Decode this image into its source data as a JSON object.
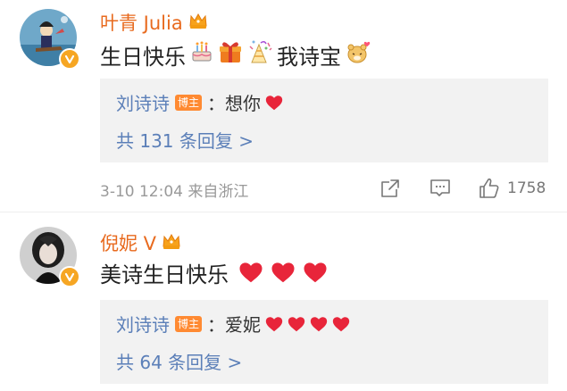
{
  "comments": [
    {
      "username": "叶青 Julia",
      "text": "生日快乐",
      "text_suffix": "我诗宝",
      "emojis_before": [
        "birthday-cake",
        "gift",
        "party-popper"
      ],
      "emojis_after": [
        "hamster-heart"
      ],
      "reply": {
        "author": "刘诗诗",
        "badge": "博主",
        "text": "：想你",
        "hearts": 1
      },
      "reply_count": "共 131 条回复 >",
      "time": "3-10 12:04  来自浙江",
      "like_count": "1758"
    },
    {
      "username": "倪妮 V",
      "text": "美诗生日快乐",
      "hearts": 3,
      "reply": {
        "author": "刘诗诗",
        "badge": "博主",
        "text": "：爱妮",
        "hearts": 4
      },
      "reply_count": "共 64 条回复 >"
    }
  ],
  "colors": {
    "username": "#e86a1e",
    "reply_author": "#5b7fb8",
    "reply_bg": "#f2f2f2",
    "heart": "#e8253a",
    "badge": "#ff8a32",
    "verified": "#f6a623"
  },
  "icons": [
    "crown-icon",
    "verified-icon",
    "share-icon",
    "comment-icon",
    "like-icon",
    "heart-icon"
  ]
}
